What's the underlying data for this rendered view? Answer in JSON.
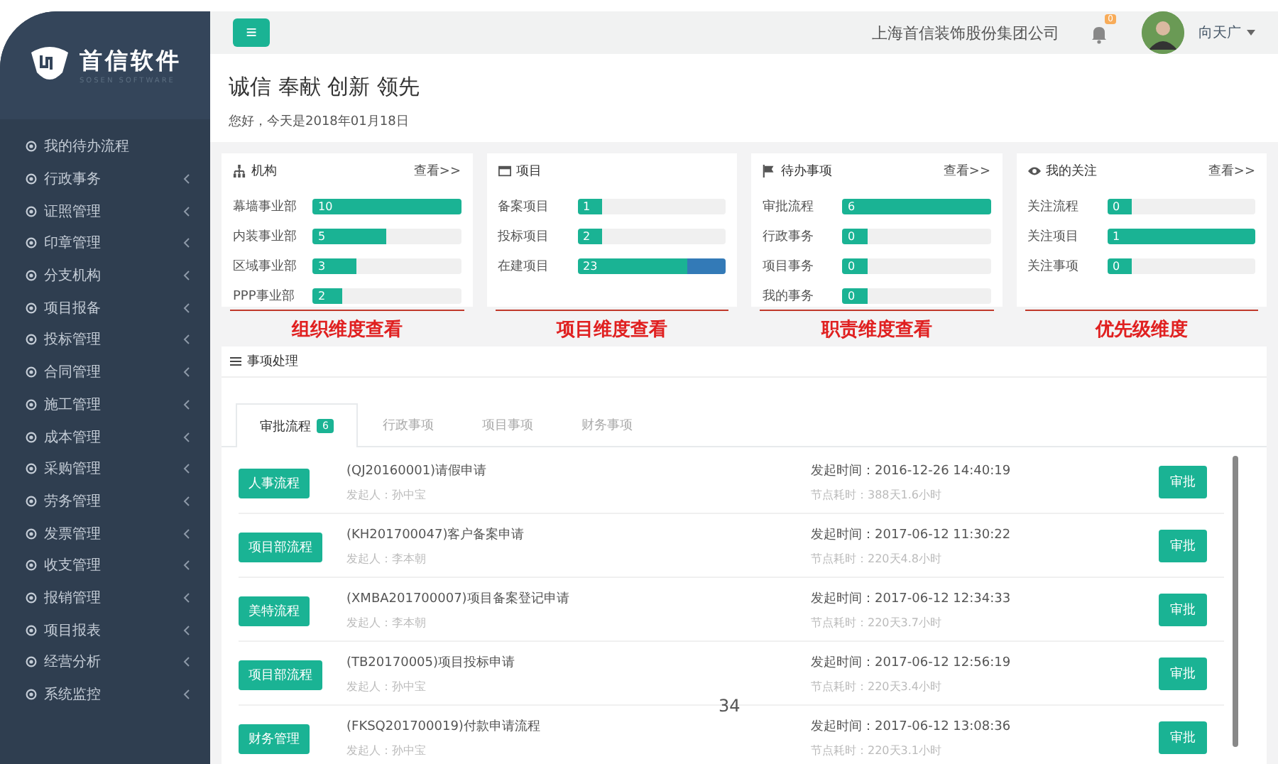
{
  "sidebar": {
    "logo": {
      "name": "首信软件",
      "tagline": "SOSEN SOFTWARE"
    },
    "items": [
      {
        "label": "我的待办流程",
        "expandable": false
      },
      {
        "label": "行政事务",
        "expandable": true
      },
      {
        "label": "证照管理",
        "expandable": true
      },
      {
        "label": "印章管理",
        "expandable": true
      },
      {
        "label": "分支机构",
        "expandable": true
      },
      {
        "label": "项目报备",
        "expandable": true
      },
      {
        "label": "投标管理",
        "expandable": true
      },
      {
        "label": "合同管理",
        "expandable": true
      },
      {
        "label": "施工管理",
        "expandable": true
      },
      {
        "label": "成本管理",
        "expandable": true
      },
      {
        "label": "采购管理",
        "expandable": true
      },
      {
        "label": "劳务管理",
        "expandable": true
      },
      {
        "label": "发票管理",
        "expandable": true
      },
      {
        "label": "收支管理",
        "expandable": true
      },
      {
        "label": "报销管理",
        "expandable": true
      },
      {
        "label": "项目报表",
        "expandable": true
      },
      {
        "label": "经营分析",
        "expandable": true
      },
      {
        "label": "系统监控",
        "expandable": true
      }
    ]
  },
  "header": {
    "menu_button": "≡",
    "company": "上海首信装饰股份集团公司",
    "notification_badge": "0",
    "user": "向天广"
  },
  "intro": {
    "slogan": "诚信 奉献 创新 领先",
    "greeting": "您好，今天是2018年01月18日"
  },
  "cards": [
    {
      "kind": "org",
      "title": "机构",
      "link": "查看>>",
      "annotation": "组织维度查看",
      "rows": [
        {
          "label": "幕墙事业部",
          "value": "10",
          "segments": [
            {
              "level": 1,
              "color": "#1ab394"
            }
          ]
        },
        {
          "label": "内装事业部",
          "value": "5",
          "segments": [
            {
              "level": 0.5,
              "color": "#1ab394"
            }
          ]
        },
        {
          "label": "区域事业部",
          "value": "3",
          "segments": [
            {
              "level": 0.3,
              "color": "#1ab394"
            }
          ]
        },
        {
          "label": "PPP事业部",
          "value": "2",
          "segments": [
            {
              "level": 0.2,
              "color": "#1ab394"
            }
          ]
        }
      ]
    },
    {
      "kind": "project",
      "title": "项目",
      "annotation": "项目维度查看",
      "rows": [
        {
          "label": "备案项目",
          "value": "1",
          "segments": [
            {
              "level": 0.17,
              "color": "#1ab394"
            }
          ]
        },
        {
          "label": "投标项目",
          "value": "2",
          "segments": [
            {
              "level": 0.17,
              "color": "#1ab394"
            }
          ]
        },
        {
          "label": "在建项目",
          "value": "23",
          "segments": [
            {
              "level": 0.74,
              "color": "#1ab394"
            },
            {
              "level": 0.26,
              "color": "#337ab7"
            }
          ]
        }
      ]
    },
    {
      "kind": "todo",
      "title": "待办事项",
      "link": "查看>>",
      "annotation": "职责维度查看",
      "rows": [
        {
          "label": "审批流程",
          "value": "6",
          "segments": [
            {
              "level": 1,
              "color": "#1ab394"
            }
          ]
        },
        {
          "label": "行政事务",
          "value": "0",
          "segments": [
            {
              "level": 0.17,
              "color": "#1ab394"
            }
          ]
        },
        {
          "label": "项目事务",
          "value": "0",
          "segments": [
            {
              "level": 0.17,
              "color": "#1ab394"
            }
          ]
        },
        {
          "label": "我的事务",
          "value": "0",
          "segments": [
            {
              "level": 0.17,
              "color": "#1ab394"
            }
          ]
        }
      ]
    },
    {
      "kind": "watch",
      "title": "我的关注",
      "link": "查看>>",
      "annotation": "优先级维度",
      "rows": [
        {
          "label": "关注流程",
          "value": "0",
          "segments": [
            {
              "level": 0.17,
              "color": "#1ab394"
            }
          ]
        },
        {
          "label": "关注项目",
          "value": "1",
          "segments": [
            {
              "level": 1,
              "color": "#1ab394"
            }
          ]
        },
        {
          "label": "关注事项",
          "value": "0",
          "segments": [
            {
              "level": 0.17,
              "color": "#1ab394"
            }
          ]
        }
      ]
    }
  ],
  "tasks": {
    "title": "事项处理",
    "tabs": [
      {
        "label": "审批流程",
        "badge": "6",
        "selected": true
      },
      {
        "label": "行政事项",
        "selected": false
      },
      {
        "label": "项目事项",
        "selected": false
      },
      {
        "label": "财务事项",
        "selected": false
      }
    ],
    "rows": [
      {
        "tag": "人事流程",
        "title": "(QJ20160001)请假申请",
        "submitter": "发起人：孙中宝",
        "start": "发起时间：2016-12-26 14:40:19",
        "elapsed": "节点耗时：388天1.6小时",
        "action": "审批"
      },
      {
        "tag": "项目部流程",
        "title": "(KH201700047)客户备案申请",
        "submitter": "发起人：李本朝",
        "start": "发起时间：2017-06-12 11:30:22",
        "elapsed": "节点耗时：220天4.8小时",
        "action": "审批"
      },
      {
        "tag": "美特流程",
        "title": "(XMBA201700007)项目备案登记申请",
        "submitter": "发起人：李本朝",
        "start": "发起时间：2017-06-12 12:34:33",
        "elapsed": "节点耗时：220天3.7小时",
        "action": "审批"
      },
      {
        "tag": "项目部流程",
        "title": "(TB20170005)项目投标申请",
        "submitter": "发起人：孙中宝",
        "start": "发起时间：2017-06-12 12:56:19",
        "elapsed": "节点耗时：220天3.4小时",
        "action": "审批"
      },
      {
        "tag": "财务管理",
        "title": "(FKSQ201700019)付款申请流程",
        "submitter": "发起人：孙中宝",
        "start": "发起时间：2017-06-12 13:08:36",
        "elapsed": "节点耗时：220天3.1小时",
        "action": "审批"
      }
    ]
  },
  "page_number": "34"
}
